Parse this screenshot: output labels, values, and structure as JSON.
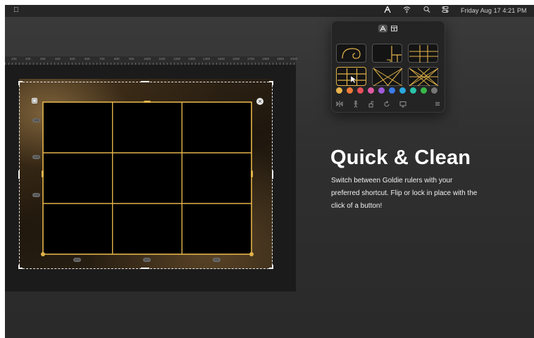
{
  "menubar": {
    "apple_icon": "apple-logo",
    "app_icon": "goldie-icon",
    "wifi_icon": "wifi-icon",
    "search_icon": "search-icon",
    "control_center_icon": "control-center-icon",
    "clock": "Friday Aug 17  4:21 PM"
  },
  "popover": {
    "tabs": [
      {
        "icon": "goldie-tab-icon",
        "active": true
      },
      {
        "icon": "layout-tab-icon",
        "active": false
      }
    ],
    "rulers": [
      {
        "name": "golden-spiral",
        "selected": false
      },
      {
        "name": "golden-section",
        "selected": false
      },
      {
        "name": "golden-grid",
        "selected": false
      },
      {
        "name": "rule-of-thirds",
        "selected": true
      },
      {
        "name": "diagonal",
        "selected": false
      },
      {
        "name": "harmonic-armature",
        "selected": false
      }
    ],
    "swatches": [
      "#e8b54a",
      "#ef7b3a",
      "#e8505b",
      "#e05aa0",
      "#a05ad8",
      "#3a7be8",
      "#2aa8e0",
      "#2ac2a8",
      "#3ab84a",
      "#777777"
    ],
    "bottom_icons": [
      "flip-horizontal-icon",
      "flip-vertical-icon",
      "lock-icon",
      "rotate-icon",
      "display-icon",
      "menu-icon"
    ]
  },
  "ruler": {
    "labels": [
      "100",
      "200",
      "300",
      "400",
      "500",
      "600",
      "700",
      "800",
      "900",
      "1000",
      "1100",
      "1200",
      "1300",
      "1400",
      "1500",
      "1600",
      "1700",
      "1800",
      "1900",
      "2000"
    ]
  },
  "canvas": {
    "accent_color": "#e2b34a",
    "grid": "3x3",
    "side_pills": [
      "128",
      "128",
      "128"
    ],
    "bottom_pills": [
      "320",
      "320",
      "320"
    ]
  },
  "marketing": {
    "headline": "Quick & Clean",
    "body_lines": [
      "Switch between Goldie rulers with your",
      "preferred shortcut. Flip or lock in place with the",
      "click of a button!"
    ]
  }
}
